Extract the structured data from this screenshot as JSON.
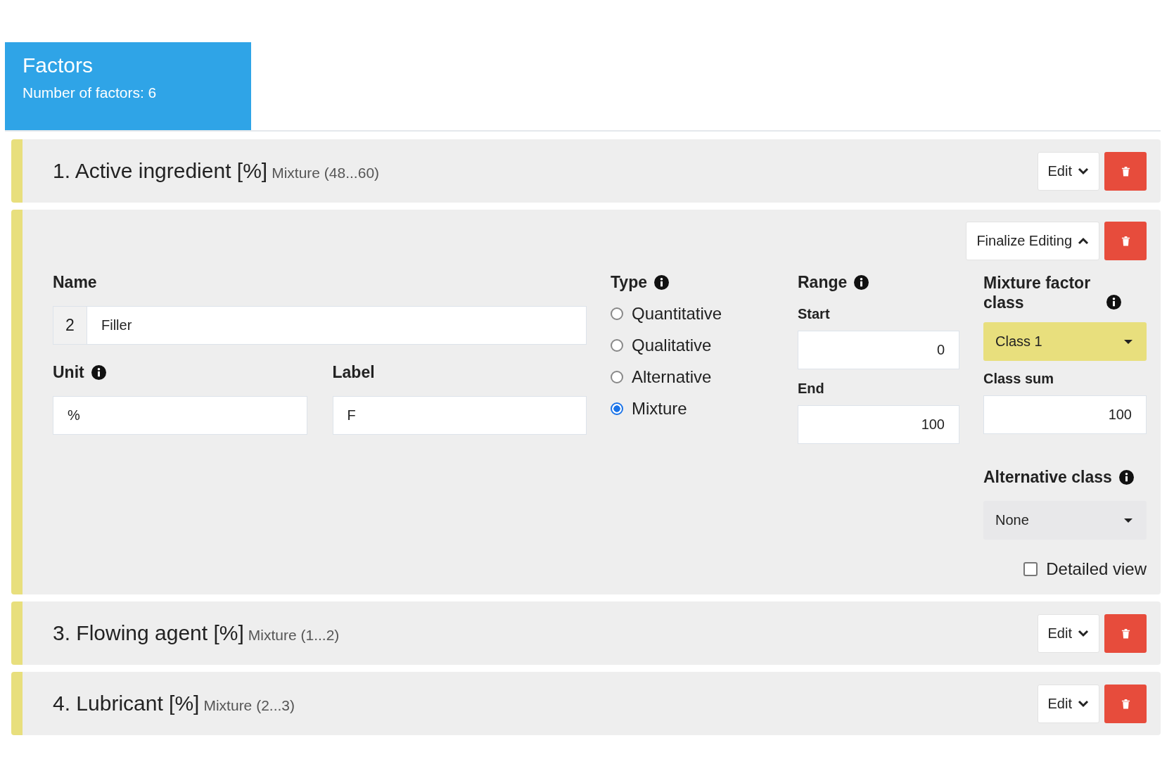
{
  "header": {
    "title": "Factors",
    "subtitle": "Number of factors: 6"
  },
  "factors": [
    {
      "kind": "collapsed",
      "title": "1. Active ingredient [%]",
      "summary": "Mixture (48...60)",
      "edit_button": "Edit"
    },
    {
      "kind": "expanded",
      "finalize_button": "Finalize Editing",
      "name_label": "Name",
      "number": "2",
      "name": "Filler",
      "unit_label": "Unit",
      "unit": "%",
      "label_label": "Label",
      "label": "F",
      "type_label": "Type",
      "types": [
        {
          "label": "Quantitative",
          "selected": false
        },
        {
          "label": "Qualitative",
          "selected": false
        },
        {
          "label": "Alternative",
          "selected": false
        },
        {
          "label": "Mixture",
          "selected": true
        }
      ],
      "range_label": "Range",
      "start_label": "Start",
      "start": "0",
      "end_label": "End",
      "end": "100",
      "mixture_class_label": "Mixture factor class",
      "mixture_class": "Class 1",
      "class_sum_label": "Class sum",
      "class_sum": "100",
      "alternative_class_label": "Alternative class",
      "alternative_class": "None",
      "detailed_view": {
        "label": "Detailed view",
        "checked": false
      }
    },
    {
      "kind": "collapsed",
      "title": "3. Flowing agent [%]",
      "summary": "Mixture (1...2)",
      "edit_button": "Edit"
    },
    {
      "kind": "collapsed",
      "title": "4. Lubricant [%]",
      "summary": "Mixture (2...3)",
      "edit_button": "Edit"
    }
  ]
}
